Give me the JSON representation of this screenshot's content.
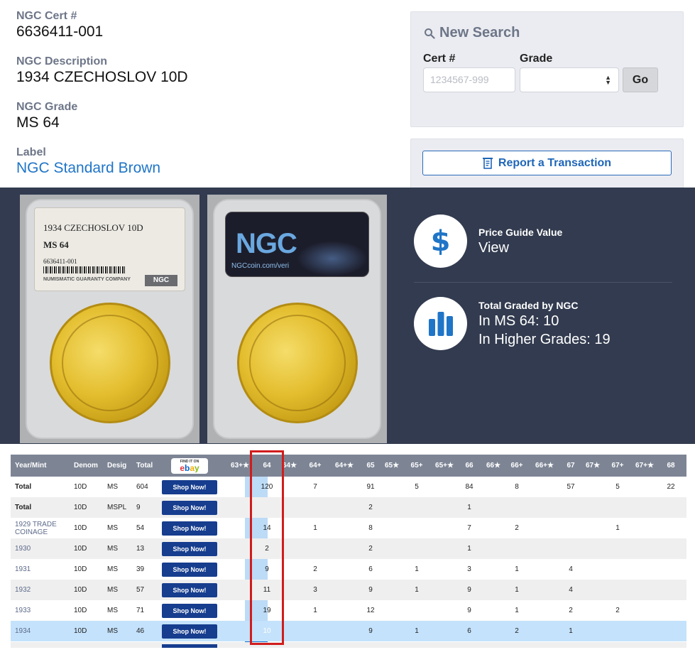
{
  "cert": {
    "cert_label": "NGC Cert #",
    "cert_value": "6636411-001",
    "desc_label": "NGC Description",
    "desc_value": "1934 CZECHOSLOV 10D",
    "grade_label": "NGC Grade",
    "grade_value": "MS 64",
    "label_label": "Label",
    "label_value": "NGC Standard Brown"
  },
  "search": {
    "title": "New Search",
    "cert_label": "Cert #",
    "cert_placeholder": "1234567-999",
    "grade_label": "Grade",
    "grade_value": "",
    "go_label": "Go"
  },
  "report": {
    "label": "Report a Transaction"
  },
  "slab": {
    "desc": "1934 CZECHOSLOV 10D",
    "grade": "MS 64",
    "cert": "6636411-001",
    "company": "NUMISMATIC GUARANTY COMPANY",
    "logo": "NGC",
    "back_logo": "NGC",
    "back_url": "NGCcoin.com/veri"
  },
  "stats": {
    "price_title": "Price Guide Value",
    "price_value": "View",
    "graded_title": "Total Graded by NGC",
    "in_grade": "In MS 64: 10",
    "higher": "In Higher Grades: 19"
  },
  "table": {
    "headers": [
      "Year/Mint",
      "Denom",
      "Desig",
      "Total"
    ],
    "ebay_small": "FIND IT ON",
    "ebay_logo": "ebay",
    "grade_cols": [
      "63+★",
      "64",
      "64★",
      "64+",
      "64+★",
      "65",
      "65★",
      "65+",
      "65+★",
      "66",
      "66★",
      "66+",
      "66+★",
      "67",
      "67★",
      "67+",
      "67+★",
      "68"
    ],
    "shop_label": "Shop Now!",
    "rows": [
      {
        "ym": "Total",
        "bold": true,
        "denom": "10D",
        "desig": "MS",
        "total": "604",
        "g": [
          "",
          "120",
          "",
          "7",
          "",
          "91",
          "",
          "5",
          "",
          "84",
          "",
          "8",
          "",
          "57",
          "",
          "5",
          "",
          "22"
        ]
      },
      {
        "ym": "Total",
        "bold": true,
        "denom": "10D",
        "desig": "MSPL",
        "total": "9",
        "g": [
          "",
          "",
          "",
          "",
          "",
          "2",
          "",
          "",
          "",
          "1",
          "",
          "",
          "",
          "",
          "",
          "",
          "",
          ""
        ]
      },
      {
        "ym": "1929 TRADE COINAGE",
        "denom": "10D",
        "desig": "MS",
        "total": "54",
        "g": [
          "",
          "14",
          "",
          "1",
          "",
          "8",
          "",
          "",
          "",
          "7",
          "",
          "2",
          "",
          "",
          "",
          "1",
          "",
          ""
        ]
      },
      {
        "ym": "1930",
        "denom": "10D",
        "desig": "MS",
        "total": "13",
        "g": [
          "",
          "2",
          "",
          "",
          "",
          "2",
          "",
          "",
          "",
          "1",
          "",
          "",
          "",
          "",
          "",
          "",
          "",
          ""
        ]
      },
      {
        "ym": "1931",
        "denom": "10D",
        "desig": "MS",
        "total": "39",
        "g": [
          "",
          "9",
          "",
          "2",
          "",
          "6",
          "",
          "1",
          "",
          "3",
          "",
          "1",
          "",
          "4",
          "",
          "",
          "",
          ""
        ]
      },
      {
        "ym": "1932",
        "denom": "10D",
        "desig": "MS",
        "total": "57",
        "g": [
          "",
          "11",
          "",
          "3",
          "",
          "9",
          "",
          "1",
          "",
          "9",
          "",
          "1",
          "",
          "4",
          "",
          "",
          "",
          ""
        ]
      },
      {
        "ym": "1933",
        "denom": "10D",
        "desig": "MS",
        "total": "71",
        "g": [
          "",
          "19",
          "",
          "1",
          "",
          "12",
          "",
          "",
          "",
          "9",
          "",
          "1",
          "",
          "2",
          "",
          "2",
          "",
          ""
        ]
      },
      {
        "ym": "1934",
        "denom": "10D",
        "desig": "MS",
        "total": "46",
        "selected": true,
        "g": [
          "",
          "10",
          "",
          "",
          "",
          "9",
          "",
          "1",
          "",
          "6",
          "",
          "2",
          "",
          "1",
          "",
          "",
          "",
          ""
        ]
      }
    ]
  },
  "colors": {
    "band": "#323b4f",
    "link": "#1f75c7",
    "shop": "#163d8e",
    "highlight": "#d11c1c",
    "selected_row": "#c4e2fb"
  },
  "icons": [
    "search-icon",
    "receipt-icon",
    "dollar-icon",
    "bar-chart-icon",
    "sort-arrows-icon"
  ]
}
